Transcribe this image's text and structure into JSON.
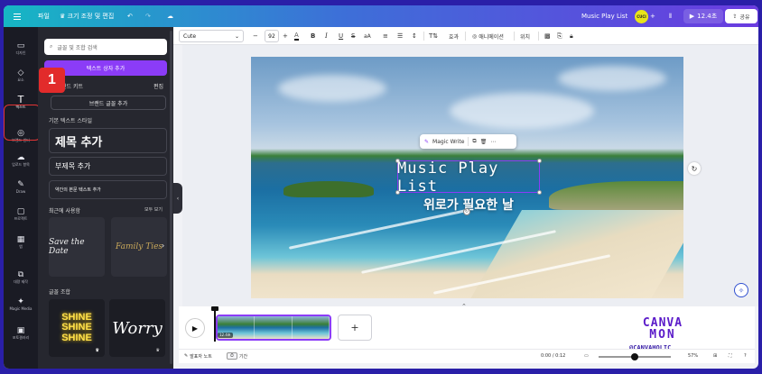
{
  "topbar": {
    "file_label": "파일",
    "resize_label": "♛ 크기 조정 및 편집",
    "title": "Music Play List",
    "avatar_text": "CUCI",
    "play_label": "12.4초",
    "share_label": "공유"
  },
  "rail": {
    "items": [
      {
        "icon": "layout-icon",
        "glyph": "▭",
        "label": "디자인"
      },
      {
        "icon": "elements-icon",
        "glyph": "◇",
        "label": "요소"
      },
      {
        "icon": "text-icon",
        "glyph": "T",
        "label": "텍스트"
      },
      {
        "icon": "brand-icon",
        "glyph": "◎",
        "label": "브랜드 센터"
      },
      {
        "icon": "upload-icon",
        "glyph": "☁",
        "label": "업로드 항목"
      },
      {
        "icon": "draw-icon",
        "glyph": "✎",
        "label": "Draw"
      },
      {
        "icon": "projects-icon",
        "glyph": "▢",
        "label": "프로젝트"
      },
      {
        "icon": "apps-icon",
        "glyph": "▦",
        "label": "앱"
      },
      {
        "icon": "bulk-create-icon",
        "glyph": "⧉",
        "label": "대량 제작"
      },
      {
        "icon": "magic-media-icon",
        "glyph": "✦",
        "label": "Magic Media"
      },
      {
        "icon": "photo-app-icon",
        "glyph": "▣",
        "label": "포토갤러리"
      }
    ],
    "active_index": 2,
    "callout_number": "1"
  },
  "panel": {
    "search_placeholder": "글꼴 및 조합 검색",
    "add_textbox_label": "텍스트 상자 추가",
    "brand_kit_label": "랜드 키트",
    "brand_kit_edit": "편집",
    "brand_fonts_label": "브랜드 글꼴 추가",
    "default_styles_label": "기본 텍스트 스타일",
    "heading_label": "제목 추가",
    "subheading_label": "부제목 추가",
    "body_label": "약간의 본문 텍스트 추가",
    "recent_label": "최근에 사용함",
    "see_all": "모두 보기",
    "recent_items": [
      "Save the Date",
      "Family Ties"
    ],
    "combos_label": "글꼴 조합",
    "combo_items": [
      "SHINE SHINE SHINE",
      "Worry"
    ]
  },
  "toolbar": {
    "font_name": "Cute",
    "font_size": "92",
    "effects_label": "효과",
    "animate_label": "애니메이션",
    "position_label": "위치"
  },
  "canvas": {
    "magic_write_label": "Magic Write",
    "slide_title": "Music Play List",
    "slide_subtitle": "위로가 필요한 날"
  },
  "timeline": {
    "clip_duration": "12.4초",
    "watermark_line1": "CANVA",
    "watermark_line2": "MON",
    "watermark_line3": "@CANVAHOLIC"
  },
  "bottombar": {
    "notes_label": "발표자 노트",
    "timer_label": "기간",
    "time_display": "0:00 / 0:12",
    "zoom_percent": "57%"
  },
  "colors": {
    "accent": "#8b3cf7",
    "callout": "#e22b2b",
    "rail_bg": "#1a1b24",
    "panel_bg": "#26272f"
  }
}
